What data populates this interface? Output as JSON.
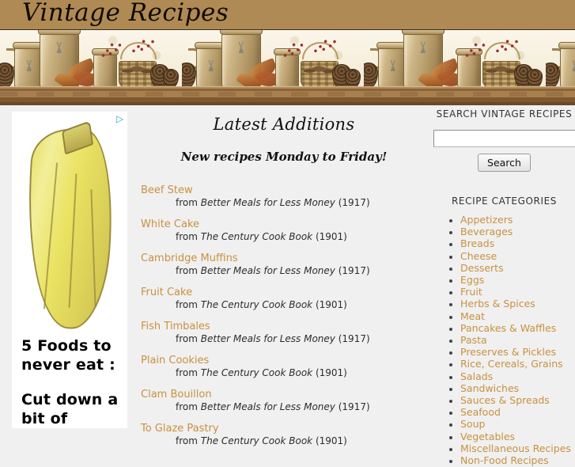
{
  "site": {
    "title": "Vintage Recipes"
  },
  "ad": {
    "adchoices_icon": "adchoices-triangle-icon",
    "line1": "5 Foods to never eat :",
    "line2": "Cut down a bit of stomach fat"
  },
  "main": {
    "heading": "Latest Additions",
    "tagline": "New recipes Monday to Friday!",
    "from_label": "from",
    "recipes": [
      {
        "name": "Beef Stew",
        "source_book": "Better Meals for Less Money",
        "source_year": "(1917)"
      },
      {
        "name": "White Cake",
        "source_book": "The Century Cook Book",
        "source_year": "(1901)"
      },
      {
        "name": "Cambridge Muffins",
        "source_book": "Better Meals for Less Money",
        "source_year": "(1917)"
      },
      {
        "name": "Fruit Cake",
        "source_book": "The Century Cook Book",
        "source_year": "(1901)"
      },
      {
        "name": "Fish Timbales",
        "source_book": "Better Meals for Less Money",
        "source_year": "(1917)"
      },
      {
        "name": "Plain Cookies",
        "source_book": "The Century Cook Book",
        "source_year": "(1901)"
      },
      {
        "name": "Clam Bouillon",
        "source_book": "Better Meals for Less Money",
        "source_year": "(1917)"
      },
      {
        "name": "To Glaze Pastry",
        "source_book": "The Century Cook Book",
        "source_year": "(1901)"
      }
    ]
  },
  "sidebar": {
    "search_heading": "SEARCH VINTAGE RECIPES",
    "search_value": "",
    "search_placeholder": "",
    "search_button": "Search",
    "categories_heading": "RECIPE CATEGORIES",
    "categories": [
      "Appetizers",
      "Beverages",
      "Breads",
      "Cheese",
      "Desserts",
      "Eggs",
      "Fruit",
      "Herbs & Spices",
      "Meat",
      "Pancakes & Waffles",
      "Pasta",
      "Preserves & Pickles",
      "Rice, Cereals, Grains",
      "Salads",
      "Sandwiches",
      "Sauces & Spreads",
      "Seafood",
      "Soup",
      "Vegetables",
      "Miscellaneous Recipes",
      "Non-Food Recipes"
    ]
  },
  "colors": {
    "masthead_bg": "#b08a54",
    "page_bg": "#f0f0f0",
    "link": "#c8913f",
    "text": "#222222"
  }
}
